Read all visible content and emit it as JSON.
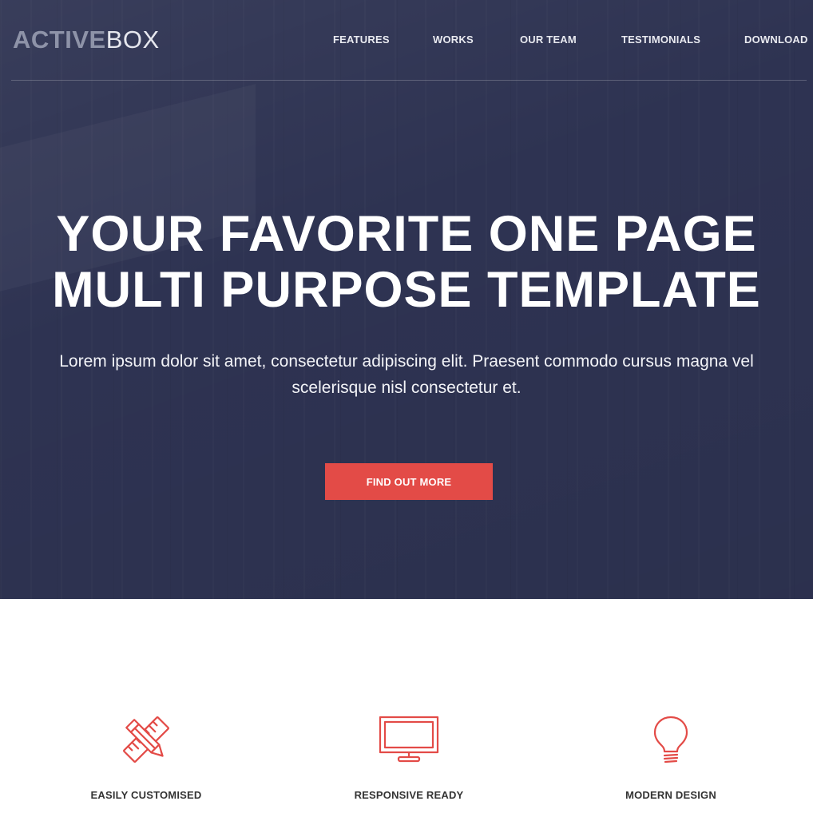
{
  "brand": {
    "logo_bold": "ACTIVE",
    "logo_light": "BOX"
  },
  "nav": {
    "items": [
      {
        "label": "FEATURES"
      },
      {
        "label": "WORKS"
      },
      {
        "label": "OUR TEAM"
      },
      {
        "label": "TESTIMONIALS"
      },
      {
        "label": "DOWNLOAD"
      }
    ]
  },
  "hero": {
    "title_line_1": "YOUR FAVORITE ONE PAGE",
    "title_line_2": "MULTI PURPOSE TEMPLATE",
    "text": "Lorem ipsum dolor sit amet, consectetur adipiscing elit. Praesent commodo cursus magna vel scelerisque nisl consectetur et.",
    "button_label": "FIND OUT MORE"
  },
  "features": [
    {
      "label": "EASILY CUSTOMISED",
      "icon": "pencil-ruler-icon"
    },
    {
      "label": "RESPONSIVE READY",
      "icon": "monitor-icon"
    },
    {
      "label": "MODERN DESIGN",
      "icon": "lightbulb-icon"
    }
  ],
  "colors": {
    "hero_background": "#2e3352",
    "accent": "#e34b47",
    "feature_label": "#333333"
  }
}
